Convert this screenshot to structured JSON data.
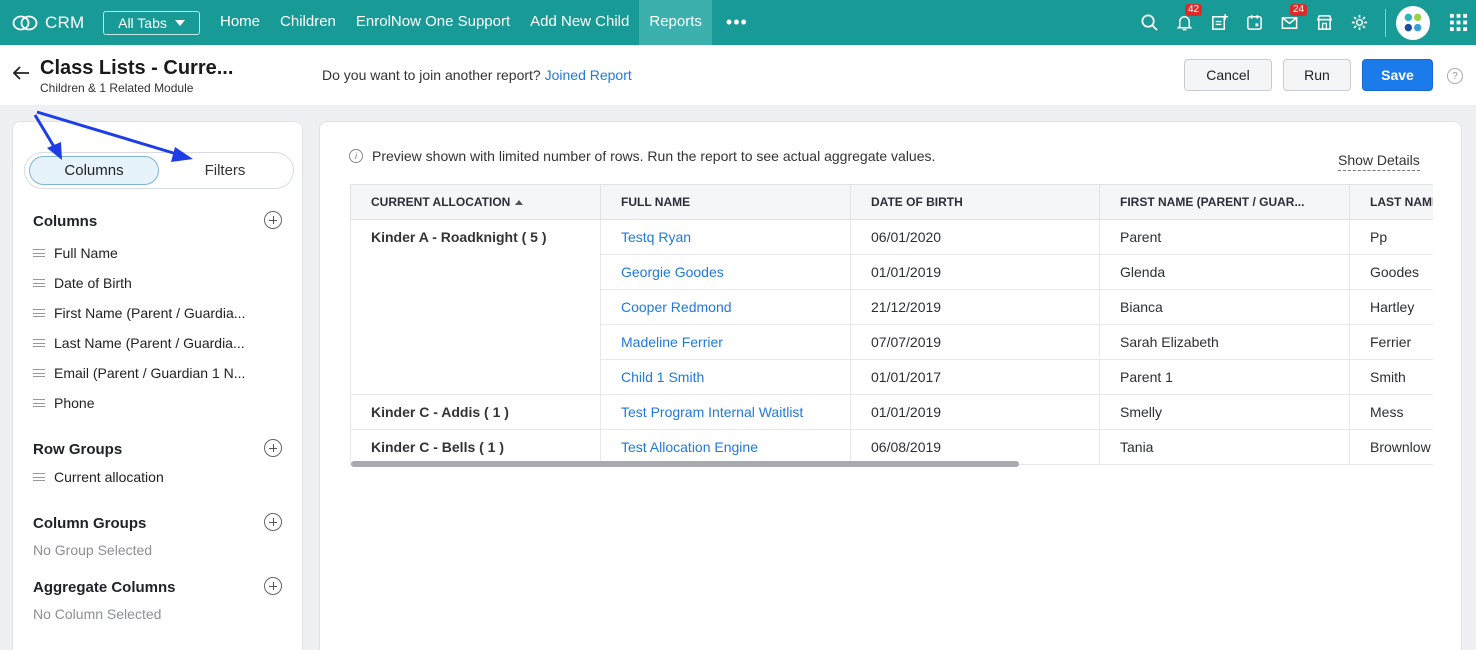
{
  "nav": {
    "brand": "CRM",
    "all_tabs": "All Tabs",
    "links": [
      "Home",
      "Children",
      "EnrolNow One Support",
      "Add New Child",
      "Reports"
    ],
    "more": "•••",
    "notification_count": "42",
    "mail_count": "24",
    "icons": [
      "search-icon",
      "bell-icon",
      "add-note-icon",
      "calendar-icon",
      "mail-icon",
      "store-icon",
      "gear-icon",
      "avatar",
      "apps-grid-icon"
    ]
  },
  "header": {
    "title": "Class Lists - Curre...",
    "subtitle": "Children & 1 Related Module",
    "join_question": "Do you want to join another report?",
    "join_link": "Joined Report",
    "cancel": "Cancel",
    "run": "Run",
    "save": "Save",
    "help": "?"
  },
  "left": {
    "tab_columns": "Columns",
    "tab_filters": "Filters",
    "columns_heading": "Columns",
    "columns": [
      "Full Name",
      "Date of Birth",
      "First Name (Parent / Guardia...",
      "Last Name (Parent / Guardia...",
      "Email (Parent / Guardian 1 N...",
      "Phone"
    ],
    "row_groups_heading": "Row Groups",
    "row_groups": [
      "Current allocation"
    ],
    "column_groups_heading": "Column Groups",
    "column_groups_empty": "No Group Selected",
    "aggregate_heading": "Aggregate Columns",
    "aggregate_empty": "No Column Selected"
  },
  "preview": {
    "info": "Preview shown with limited number of rows. Run the report to see actual aggregate values.",
    "show_details": "Show Details",
    "headers": [
      "CURRENT ALLOCATION",
      "FULL NAME",
      "DATE OF BIRTH",
      "FIRST NAME (PARENT / GUAR...",
      "LAST NAME"
    ],
    "groups": [
      {
        "label": "Kinder A - Roadknight ( 5 )",
        "rows": [
          [
            "Testq Ryan",
            "06/01/2020",
            "Parent",
            "Pp"
          ],
          [
            "Georgie Goodes",
            "01/01/2019",
            "Glenda",
            "Goodes"
          ],
          [
            "Cooper Redmond",
            "21/12/2019",
            "Bianca",
            "Hartley"
          ],
          [
            "Madeline Ferrier",
            "07/07/2019",
            "Sarah Elizabeth",
            "Ferrier"
          ],
          [
            "Child 1 Smith",
            "01/01/2017",
            "Parent 1",
            "Smith"
          ]
        ]
      },
      {
        "label": "Kinder C - Addis ( 1 )",
        "rows": [
          [
            "Test Program Internal Waitlist",
            "01/01/2019",
            "Smelly",
            "Mess"
          ]
        ]
      },
      {
        "label": "Kinder C - Bells ( 1 )",
        "rows": [
          [
            "Test Allocation Engine",
            "06/08/2019",
            "Tania",
            "Brownlow"
          ]
        ]
      }
    ]
  },
  "colors": {
    "nav_bg": "#189a97",
    "nav_active": "#3bb0ad",
    "link": "#1f7ad8",
    "primary_button": "#1b7bea",
    "annotation_arrow": "#1d3de6"
  }
}
